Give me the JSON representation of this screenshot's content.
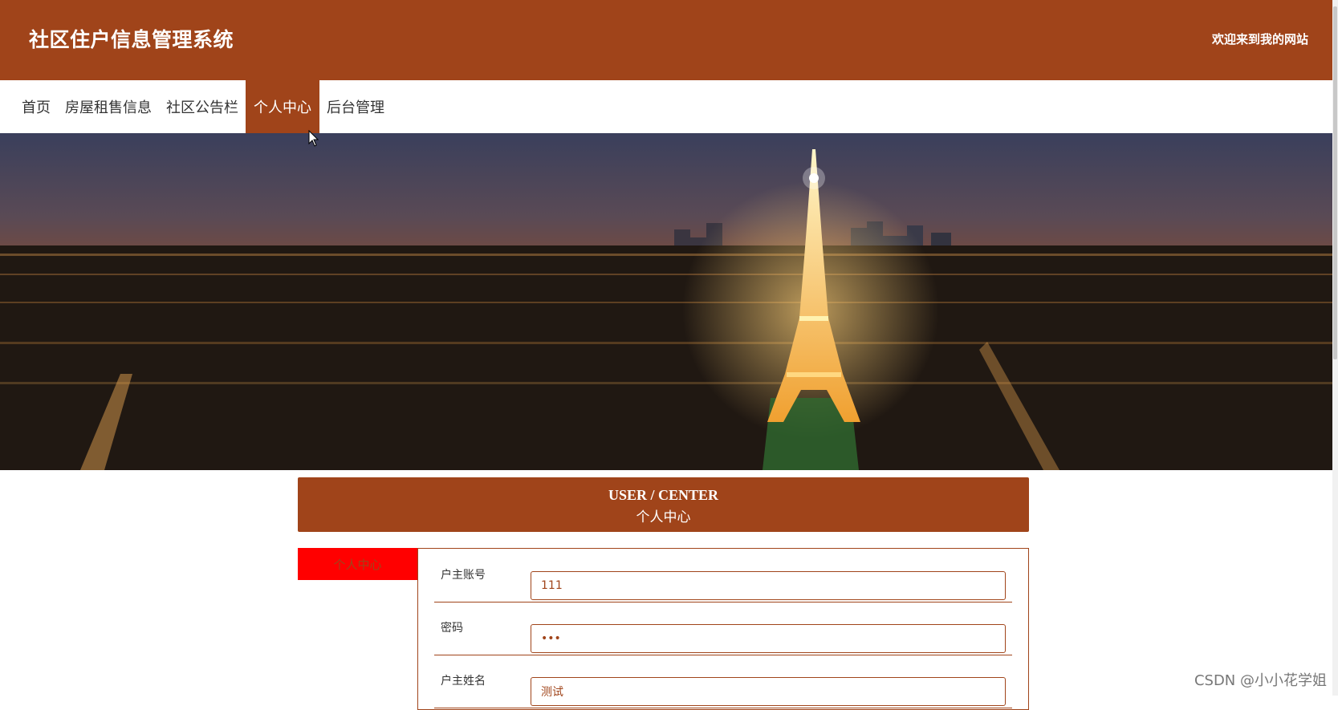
{
  "header": {
    "title": "社区住户信息管理系统",
    "welcome": "欢迎来到我的网站"
  },
  "nav": {
    "items": [
      {
        "label": "首页"
      },
      {
        "label": "房屋租售信息"
      },
      {
        "label": "社区公告栏"
      },
      {
        "label": "个人中心",
        "active": true
      },
      {
        "label": "后台管理"
      }
    ]
  },
  "carousel": {
    "slide_count": 3,
    "active_index": 0
  },
  "user_center": {
    "title_en": "USER / CENTER",
    "title_cn": "个人中心",
    "side_tab": "个人中心"
  },
  "form": {
    "fields": [
      {
        "label": "户主账号",
        "value": "111"
      },
      {
        "label": "密码",
        "value": "•••"
      },
      {
        "label": "户主姓名",
        "value": "测试"
      }
    ]
  },
  "watermark": "CSDN @小小花学姐",
  "colors": {
    "brand": "#a0441a",
    "side_tab": "#ff0000"
  }
}
